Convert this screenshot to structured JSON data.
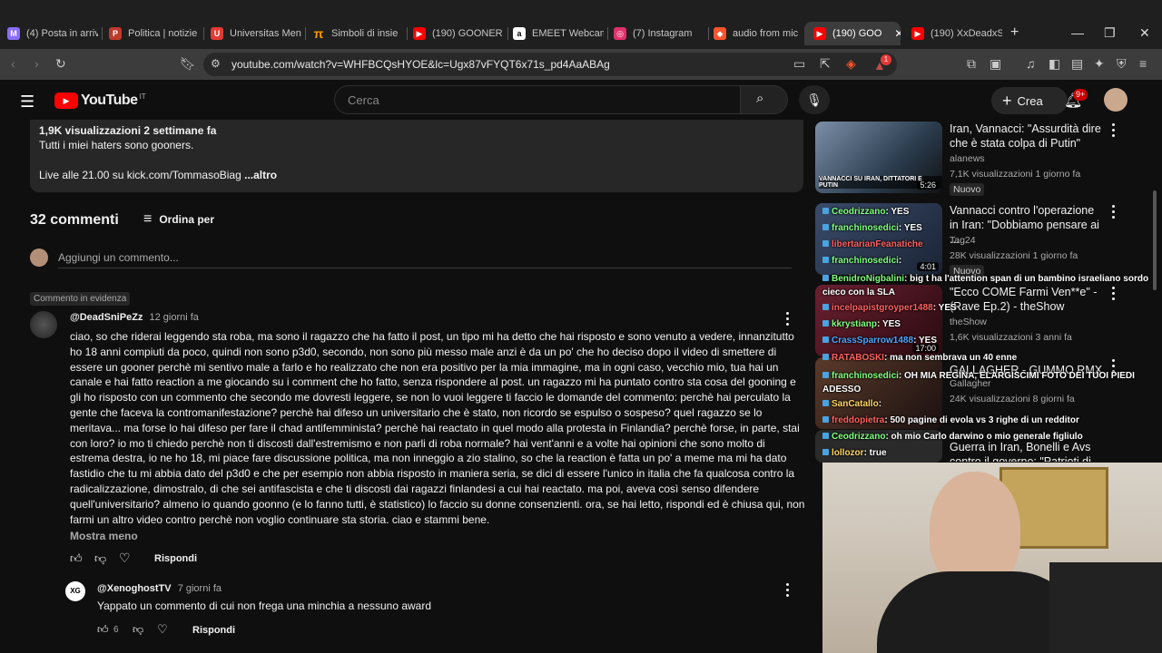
{
  "browser": {
    "tabs": [
      {
        "label": "(4) Posta in arriv",
        "icon": "gmail-icon",
        "color": "#8a6cff"
      },
      {
        "label": "Politica | notizie",
        "icon": "globe-icon",
        "color": "#c0392b"
      },
      {
        "label": "Universitas Men",
        "icon": "bookmark-icon",
        "color": "#e53935"
      },
      {
        "label": "Simboli di insie",
        "icon": "pi-icon",
        "color": "#ff9800"
      },
      {
        "label": "(190) GOONER",
        "icon": "youtube-icon",
        "color": "#ff0000"
      },
      {
        "label": "EMEET Webcam",
        "icon": "amazon-icon",
        "color": "#ffffff"
      },
      {
        "label": "(7) Instagram",
        "icon": "instagram-icon",
        "color": "#e1306c"
      },
      {
        "label": "audio from mic",
        "icon": "brave-icon",
        "color": "#fb542b"
      },
      {
        "label": "(190) GOO",
        "icon": "youtube-icon",
        "color": "#ff0000"
      },
      {
        "label": "(190) XxDeadxS",
        "icon": "youtube-icon",
        "color": "#ff0000"
      }
    ],
    "url": "youtube.com/watch?v=WHFBCQsHYOE&lc=Ugx87vFYQT6x71s_pd4AaABAg",
    "shields_badge": "1"
  },
  "youtube": {
    "logo_text": "YouTube",
    "region": "IT",
    "search_placeholder": "Cerca",
    "create_label": "Crea",
    "notifications": "9+"
  },
  "description": {
    "stats": "1,9K visualizzazioni  2 settimane fa",
    "line1": "Tutti i miei haters sono gooners.",
    "line2": "Live alle 21.00 su kick.com/TommasoBiag",
    "more": "...altro"
  },
  "comments": {
    "count_label": "32 commenti",
    "sort_label": "Ordina per",
    "add_placeholder": "Aggiungi un commento...",
    "pinned_label": "Commento in evidenza",
    "items": [
      {
        "author": "@DeadSniPeZz",
        "time": "12 giorni fa",
        "text": "ciao, so che riderai leggendo sta roba, ma sono il ragazzo che ha fatto il post, un tipo mi ha detto che hai risposto e sono venuto a vedere, innanzitutto ho 18 anni compiuti da poco, quindi non sono p3d0, secondo, non sono più messo male anzi è da un po' che ho deciso dopo il video di smettere di essere un gooner perchè mi sentivo male a farlo e ho realizzato che non era positivo per la mia immagine, ma in ogni caso, vecchio mio, tua hai un canale e hai fatto reaction a me giocando su i comment che ho fatto, senza rispondere al post. un ragazzo mi ha puntato contro sta cosa del gooning e gli ho risposto con un commento che secondo me dovresti leggere, se non lo vuoi leggere ti faccio le domande del commento: perchè hai perculato la gente che faceva la contromanifestazione? perchè hai difeso un universitario che è stato, non ricordo se espulso o sospeso? quel ragazzo se lo meritava... ma forse lo hai difeso per fare il chad antifemminista? perchè hai reactato in quel modo alla protesta in Finlandia? perchè forse, in parte, stai con loro? io mo ti chiedo perchè non ti discosti dall'estremismo e non parli di roba normale? hai vent'anni e a volte hai opinioni che sono molto di estrema destra, io ne ho 18, mi piace fare discussione politica, ma non inneggio a zio stalino, so che la reaction è fatta un po' a meme ma mi ha dato fastidio che tu mi abbia dato del p3d0 e che per esempio non abbia risposto in maniera seria, se dici di essere l'unico in italia che fa qualcosa contro la radicalizzazione, dimostralo, di che sei antifascista e che ti discosti dai ragazzi finlandesi a cui hai reactato. ma poi, aveva così senso difendere quell'universitario? almeno io quando goonno (e lo fanno tutti, è statistico) lo faccio su donne consenzienti. ora, se hai letto, rispondi ed è chiusa qui, non farmi un altro video contro perchè non voglio continuare sta storia. ciao e stammi bene.",
        "less_label": "Mostra meno",
        "reply_label": "Rispondi"
      },
      {
        "author": "@XenoghostTV",
        "time": "7 giorni fa",
        "avatar_text": "XG",
        "text": "Yappato un commento di cui non frega una minchia a nessuno award",
        "likes": "6",
        "reply_label": "Rispondi"
      }
    ]
  },
  "sidebar": {
    "videos": [
      {
        "title": "Iran, Vannacci: \"Assurdità dire che è stata colpa di Putin\"",
        "channel": "alanews",
        "meta": "7,1K visualizzazioni  1 giorno fa",
        "badge": "Nuovo",
        "duration": "5:26",
        "thumb_caption": "VANNACCI SU IRAN, DITTATORI E PUTIN"
      },
      {
        "title": "Vannacci contro l'operazione in Iran: \"Dobbiamo pensare ai ...",
        "channel": "Tag24",
        "meta": "28K visualizzazioni  1 giorno fa",
        "badge": "Nuovo",
        "duration": "4:01"
      },
      {
        "title": "\"Ecco COME Farmi Ven**e\" - (Rave Ep.2) - theShow",
        "channel": "theShow",
        "meta": "1,6K visualizzazioni  3 anni fa",
        "duration": "17:00"
      },
      {
        "title": "GALLAGHER - GUMMO RMX",
        "channel": "Gallagher",
        "meta": "24K visualizzazioni  8 giorni fa"
      },
      {
        "title": "Guerra in Iran, Bonelli e Avs contro il governo: \"Patrioti di",
        "channel": "",
        "meta": ""
      }
    ]
  },
  "chat": [
    {
      "user": "Ceodrizzano",
      "msg": ": YES",
      "cls": "u"
    },
    {
      "user": "franchinosedici",
      "msg": ": YES",
      "cls": "u"
    },
    {
      "user": "libertarianFeanatiche",
      "msg": "",
      "cls": "ur"
    },
    {
      "user": "franchinosedici",
      "msg": ":",
      "cls": "u"
    },
    {
      "user": "BenidroNigbalini",
      "msg": ": big t ha l'attention span di un bambino israeliano sordo cieco con la SLA",
      "cls": "u"
    },
    {
      "user": "incelpapistgroyper1488",
      "msg": ": YES",
      "cls": "ur"
    },
    {
      "user": "kkrystianp",
      "msg": ": YES",
      "cls": "u"
    },
    {
      "user": "CrassSparrow1488",
      "msg": ": YES",
      "cls": "ub"
    },
    {
      "user": "RATABOSKI",
      "msg": ": ma non sembrava un 40 enne",
      "cls": "ur"
    },
    {
      "user": "franchinosedici",
      "msg": ": OH MIA REGINA, ELARGISCIMI FOTO DEI TUOI PIEDI ADESSO",
      "cls": "u"
    },
    {
      "user": "SanCatallo",
      "msg": ":",
      "cls": "uy"
    },
    {
      "user": "freddopietra",
      "msg": ": 500 pagine di evola vs 3 righe di un redditor",
      "cls": "ur"
    },
    {
      "user": "Ceodrizzano",
      "msg": ": oh mio Carlo darwino o mio generale figliulo",
      "cls": "u"
    },
    {
      "user": "lollozor",
      "msg": ": true",
      "cls": "uy"
    }
  ]
}
